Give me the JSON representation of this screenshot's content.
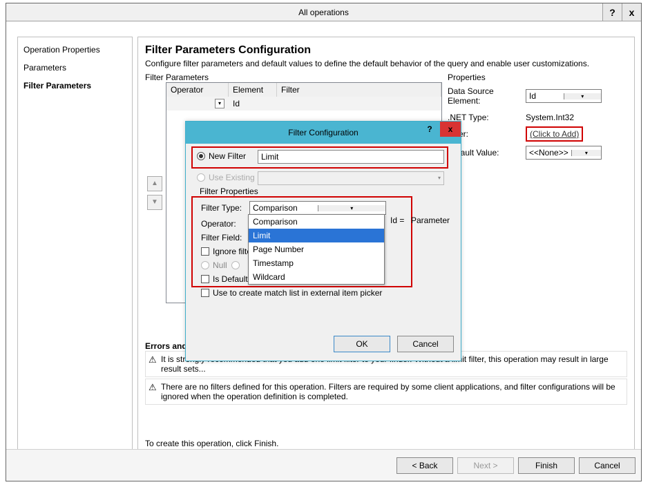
{
  "window": {
    "title": "All operations",
    "help_icon": "?",
    "close_icon": "x"
  },
  "nav": {
    "items": [
      {
        "label": "Operation Properties"
      },
      {
        "label": "Parameters"
      },
      {
        "label": "Filter Parameters"
      }
    ]
  },
  "main": {
    "heading": "Filter Parameters Configuration",
    "description": "Configure filter parameters and default values to define the default behavior of the query and enable user customizations.",
    "filter_params_label": "Filter Parameters",
    "table": {
      "headers": {
        "operator": "Operator",
        "element": "Element",
        "filter": "Filter"
      },
      "row1": {
        "element": "Id"
      }
    },
    "properties_label": "Properties",
    "properties": {
      "data_source_label": "Data Source Element:",
      "data_source_value": "Id",
      "net_type_label": ".NET Type:",
      "net_type_value": "System.Int32",
      "filter_label": "Filter:",
      "filter_value": "(Click to Add)",
      "default_value_label": "Default Value:",
      "default_value_value": "<<None>>"
    },
    "errors_label": "Errors and Warnings",
    "errors": [
      "It is strongly recommended that you add one limit filter to your finder. Without a limit filter, this operation may result in large result sets...",
      "There are no filters defined for this operation. Filters are required by some client applications, and filter configurations will be ignored when the operation definition is completed."
    ],
    "footer_hint": "To create this operation, click Finish."
  },
  "buttons": {
    "back": "< Back",
    "next": "Next >",
    "finish": "Finish",
    "cancel": "Cancel"
  },
  "modal": {
    "title": "Filter Configuration",
    "help_icon": "?",
    "close_icon": "x",
    "new_filter_label": "New Filter",
    "new_filter_value": "Limit",
    "use_existing_label": "Use Existing",
    "fp_label": "Filter Properties",
    "filter_type_label": "Filter Type:",
    "filter_type_value": "Comparison",
    "operator_label": "Operator:",
    "id_eq": "Id =",
    "param_label": "Parameter",
    "filter_field_label": "Filter Field:",
    "ignore_label": "Ignore filter...",
    "null_label": "Null",
    "is_default_label": "Is Default",
    "match_list_label": "Use to create match list in external item picker",
    "options": {
      "o1": "Comparison",
      "o2": "Limit",
      "o3": "Page Number",
      "o4": "Timestamp",
      "o5": "Wildcard"
    },
    "ok": "OK",
    "cancel": "Cancel"
  }
}
